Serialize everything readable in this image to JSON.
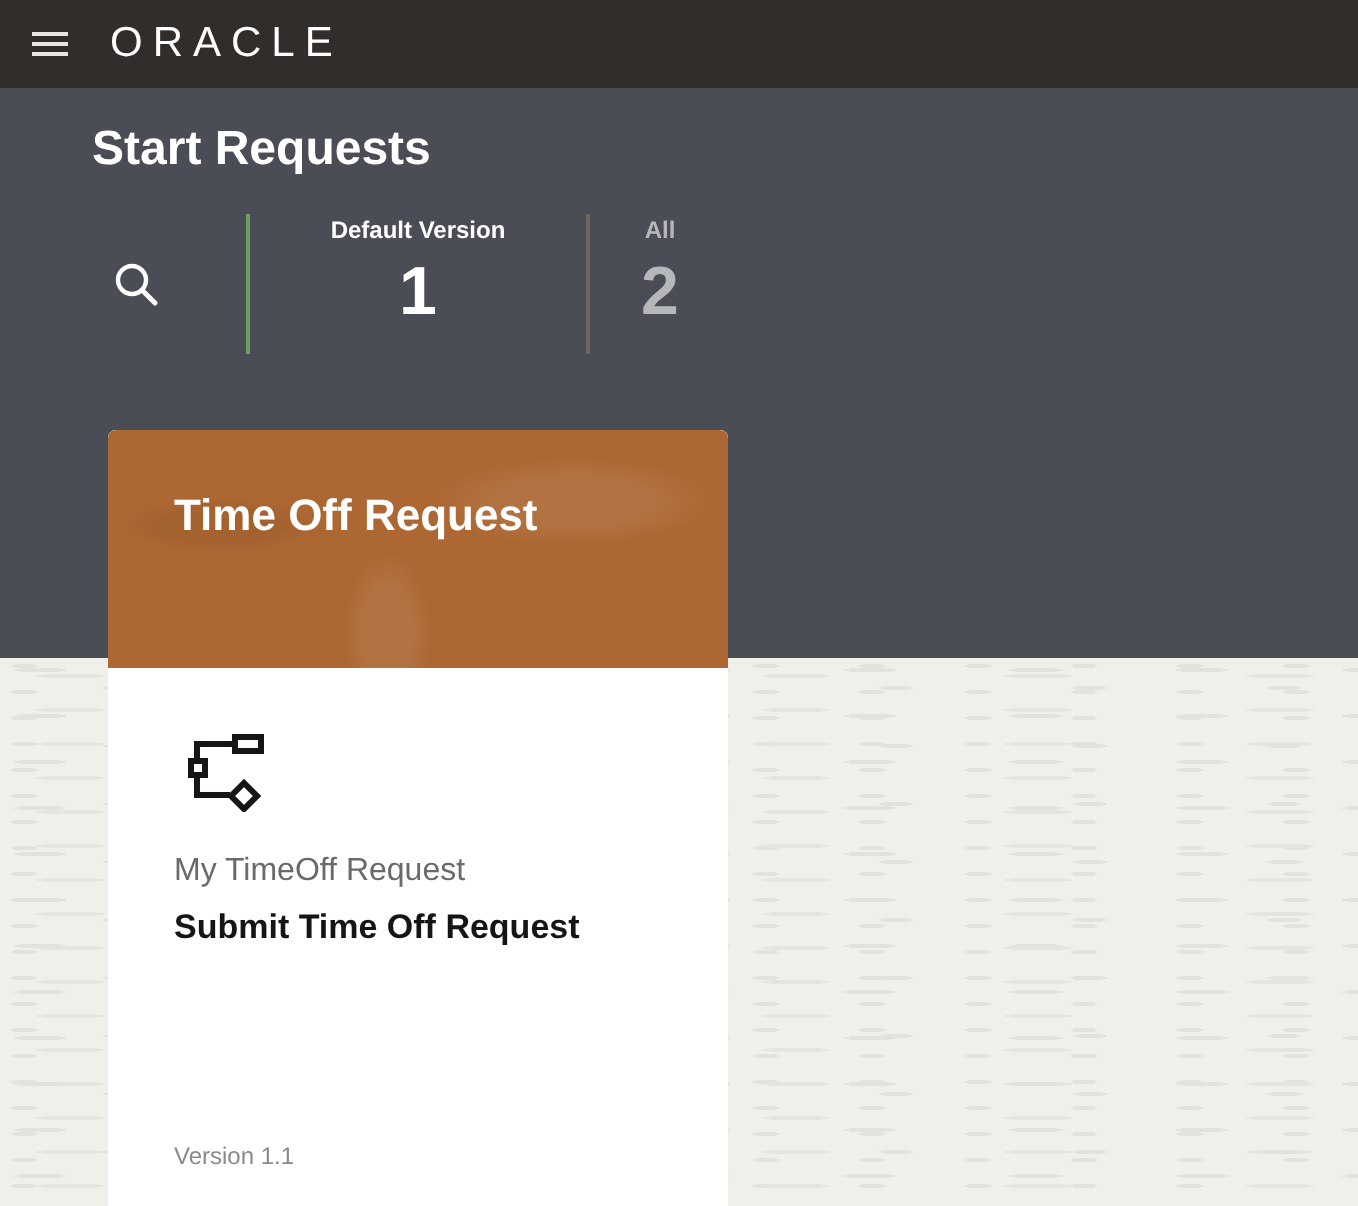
{
  "header": {
    "logo": "ORACLE"
  },
  "page": {
    "title": "Start Requests"
  },
  "filters": [
    {
      "label": "Default Version",
      "count": "1",
      "selected": true
    },
    {
      "label": "All",
      "count": "2",
      "selected": false
    }
  ],
  "cards": [
    {
      "title": "Time Off Request",
      "application": "My TimeOff Request",
      "name": "Submit Time Off Request",
      "version": "Version 1.1"
    }
  ]
}
